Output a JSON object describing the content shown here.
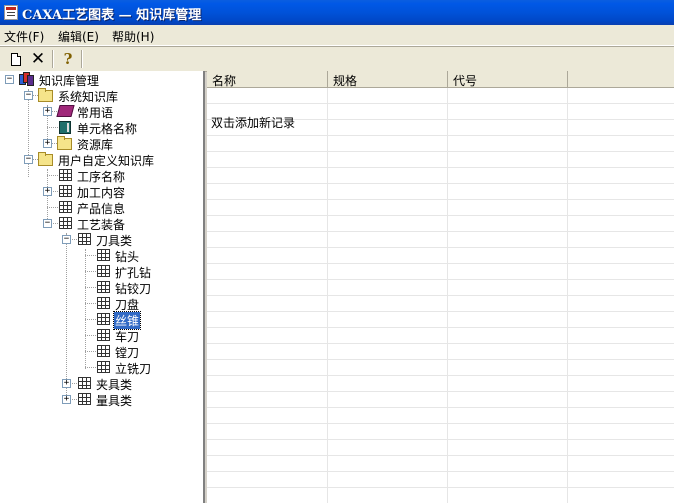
{
  "window": {
    "title": "CAXA工艺图表 — 知识库管理"
  },
  "menu": [
    {
      "label": "文件(F)"
    },
    {
      "label": "编辑(E)"
    },
    {
      "label": "帮助(H)"
    }
  ],
  "toolbar": {
    "icons": [
      "new-document-icon",
      "delete-icon",
      "help-icon"
    ]
  },
  "tree": {
    "root": "知识库管理",
    "system": "系统知识库",
    "common_phrases": "常用语",
    "cell_names": "单元格名称",
    "resources": "资源库",
    "user": "用户自定义知识库",
    "process_names": "工序名称",
    "machining": "加工内容",
    "product_info": "产品信息",
    "equipment": "工艺装备",
    "cutters": "刀具类",
    "drill": "钻头",
    "reamer_drill": "扩孔钻",
    "drill_reamer": "钻铰刀",
    "disc_cutter": "刀盘",
    "tap": "丝锥",
    "turning_tool": "车刀",
    "boring_tool": "镗刀",
    "end_mill": "立铣刀",
    "fixtures": "夹具类",
    "gauges": "量具类",
    "selected": "丝锥"
  },
  "list": {
    "columns": [
      "名称",
      "规格",
      "代号"
    ],
    "add_hint": "双击添加新记录"
  }
}
